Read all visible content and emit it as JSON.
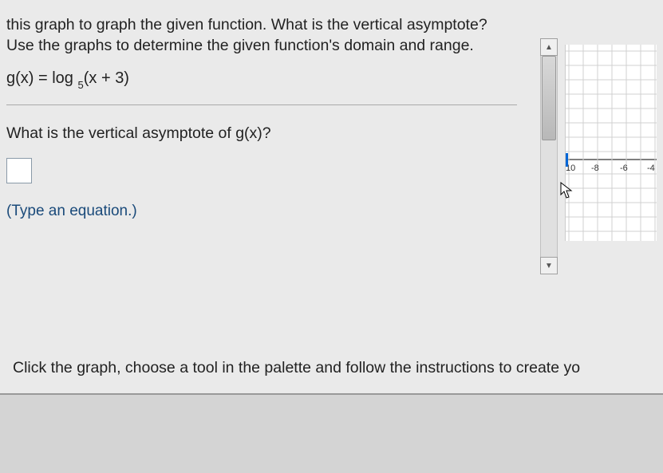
{
  "problem": {
    "intro": "this graph to graph the given function. What is the vertical asymptote? Use the graphs to determine the given function's domain and range.",
    "equation_left": "g(x) = log",
    "equation_sub": "5",
    "equation_right": "(x + 3)",
    "question": "What is the vertical asymptote of g(x)?",
    "hint": "(Type an equation.)",
    "footer": "Click the graph, choose a tool in the palette and follow the instructions to create yo"
  },
  "scrollbar": {
    "up_glyph": "▲",
    "down_glyph": "▼"
  },
  "graph": {
    "ticks": {
      "t0": "10",
      "t1": "-8",
      "t2": "-6",
      "t3": "-4"
    }
  },
  "cursor_glyph": "↖"
}
